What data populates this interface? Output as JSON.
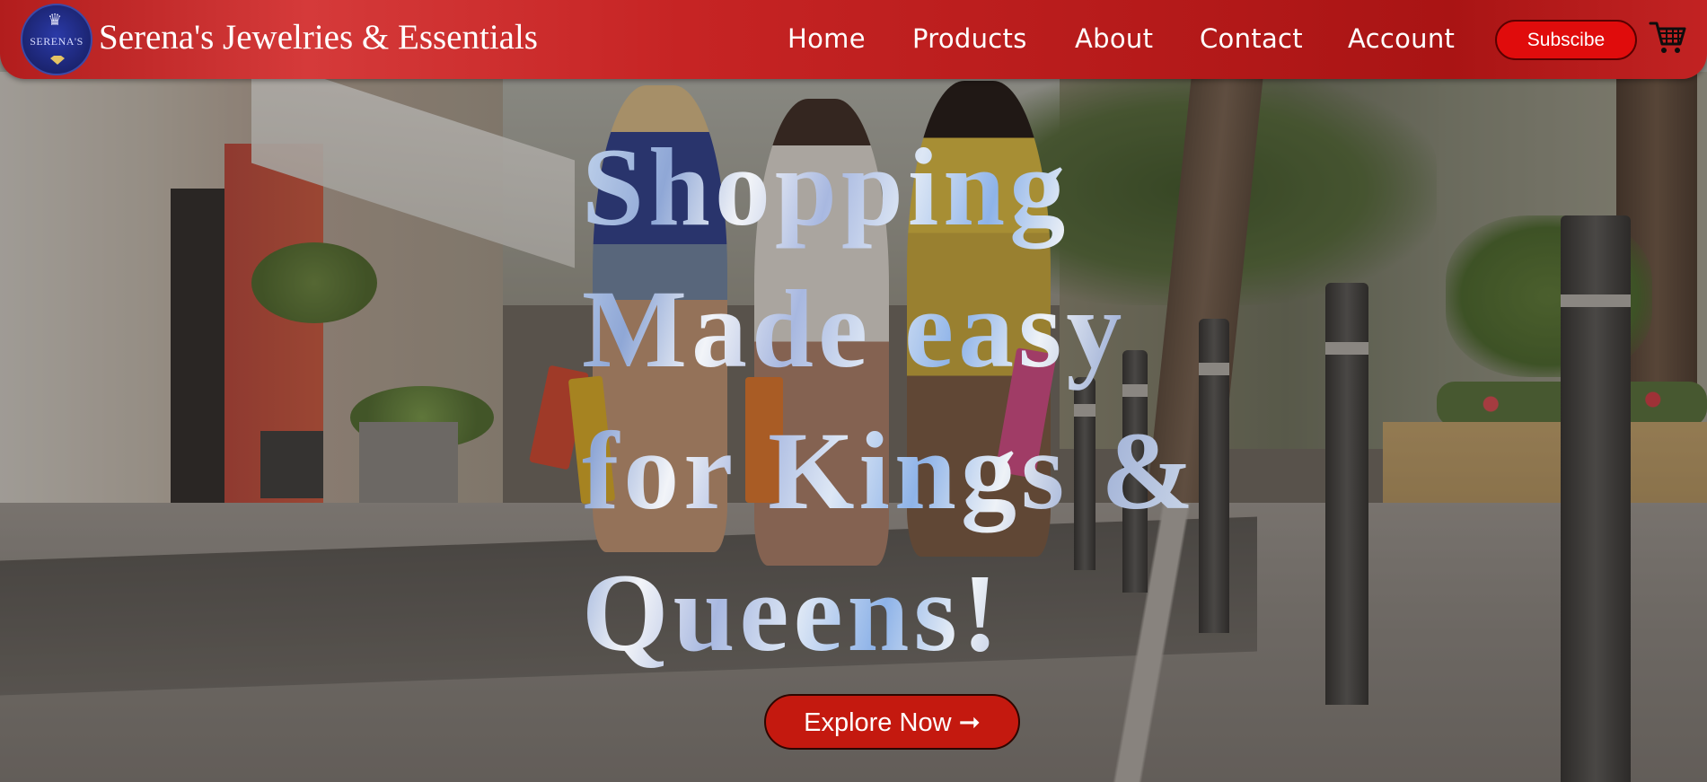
{
  "header": {
    "logo_text": "SERENA'S",
    "brand": "Serena's Jewelries & Essentials",
    "nav": [
      {
        "label": "Home"
      },
      {
        "label": "Products"
      },
      {
        "label": "About"
      },
      {
        "label": "Contact"
      },
      {
        "label": "Account"
      }
    ],
    "subscribe_label": "Subscibe",
    "cart_icon": "shopping-cart-icon"
  },
  "hero": {
    "headline_lines": [
      "Shopping",
      "Made easy",
      "for Kings &",
      "Queens!"
    ],
    "cta_label": "Explore Now ➞"
  },
  "colors": {
    "header_red": "#c62424",
    "button_red": "#e00c0c",
    "cta_red": "#c4190f",
    "text_white": "#ffffff"
  }
}
